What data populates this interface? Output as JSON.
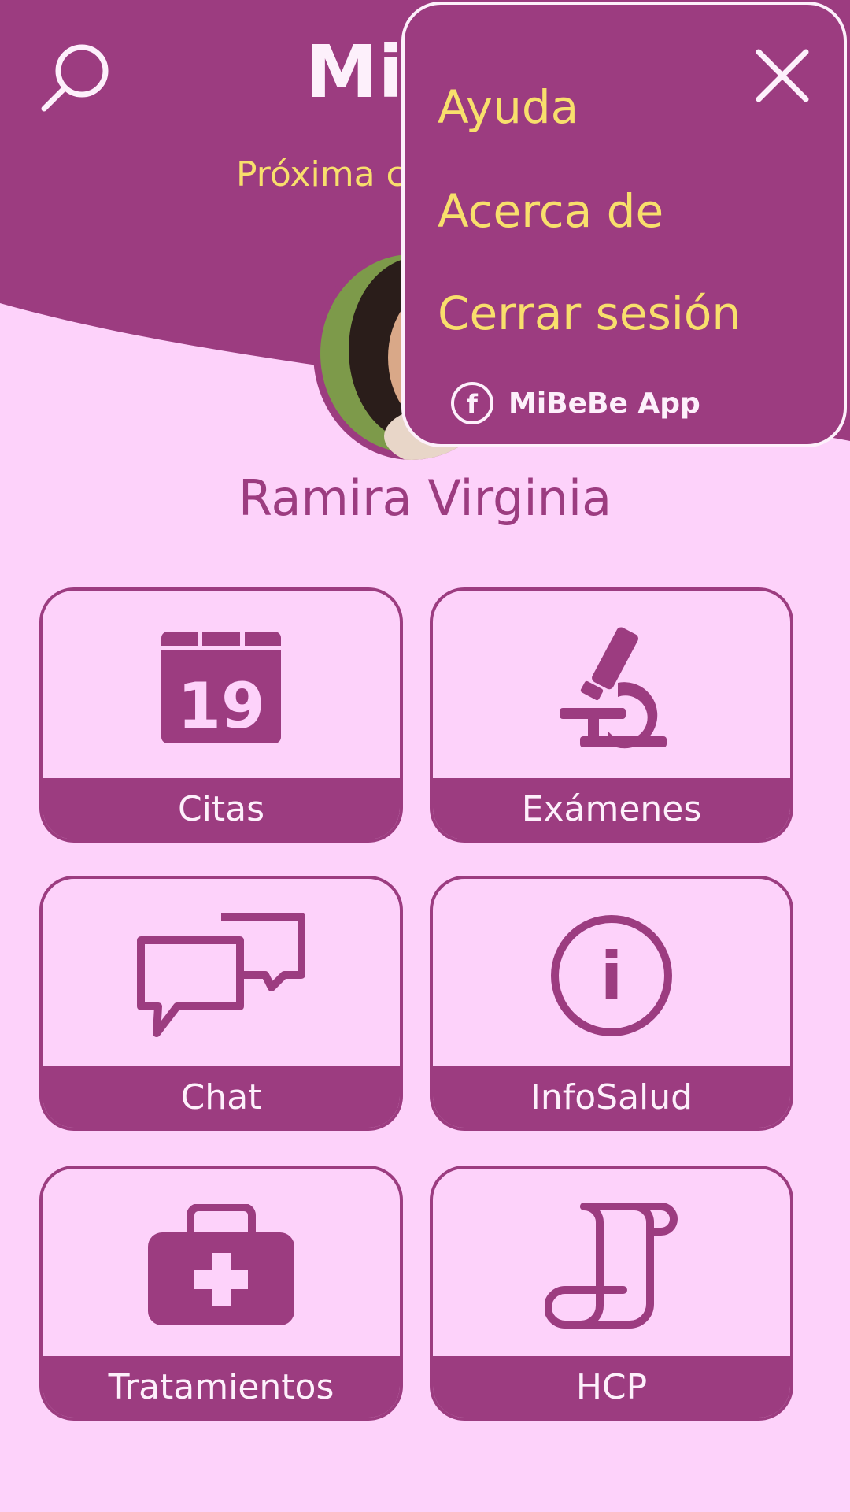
{
  "app": {
    "title": "Mi"
  },
  "header": {
    "next_appointment": "Próxima c",
    "search_icon": "search-icon"
  },
  "user": {
    "name": "Ramira Virginia"
  },
  "menu": {
    "items": [
      {
        "label": "Ayuda"
      },
      {
        "label": "Acerca de"
      },
      {
        "label": "Cerrar sesión"
      }
    ],
    "facebook_label": "MiBeBe App",
    "close_icon": "close-icon"
  },
  "tiles": [
    {
      "label": "Citas",
      "icon": "calendar-icon",
      "calendar_day": "19"
    },
    {
      "label": "Exámenes",
      "icon": "microscope-icon"
    },
    {
      "label": "Chat",
      "icon": "chat-bubbles-icon"
    },
    {
      "label": "InfoSalud",
      "icon": "info-icon",
      "info_glyph": "i"
    },
    {
      "label": "Tratamientos",
      "icon": "medical-kit-icon"
    },
    {
      "label": "HCP",
      "icon": "scroll-icon"
    }
  ],
  "colors": {
    "primary": "#9c3c80",
    "background": "#fdd2fa",
    "accent_text": "#f8df6c",
    "light_text": "#fdf0fb"
  }
}
